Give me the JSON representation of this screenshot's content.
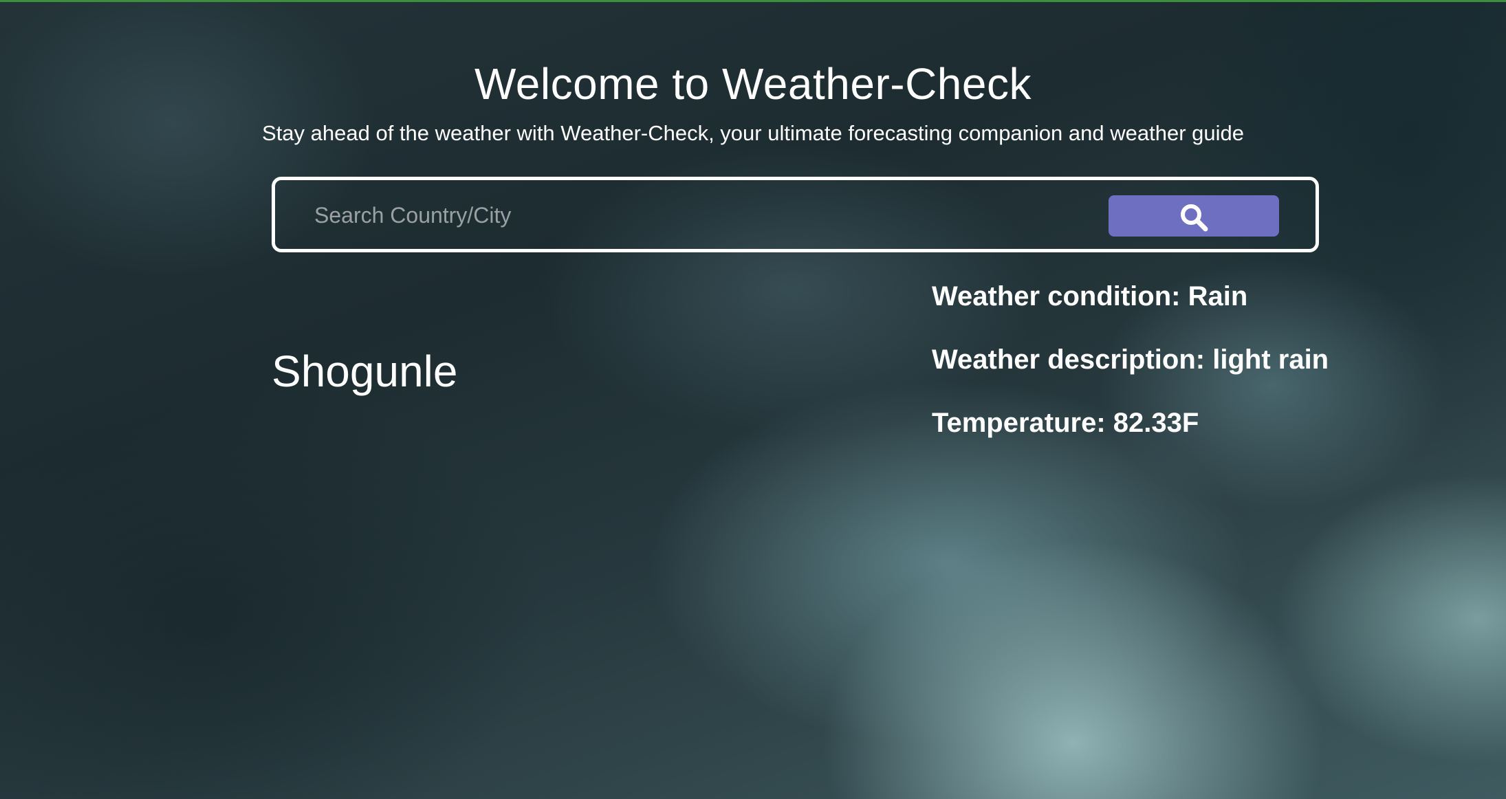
{
  "header": {
    "title": "Welcome to Weather-Check",
    "subtitle": "Stay ahead of the weather with Weather-Check, your ultimate forecasting companion and weather guide"
  },
  "search": {
    "placeholder": "Search Country/City",
    "value": "",
    "button_icon": "search-icon",
    "button_color": "#6f6fc2"
  },
  "result": {
    "city": "Shogunle",
    "condition": "Weather condition: Rain",
    "description": "Weather description: light rain",
    "temperature": "Temperature: 82.33F"
  }
}
